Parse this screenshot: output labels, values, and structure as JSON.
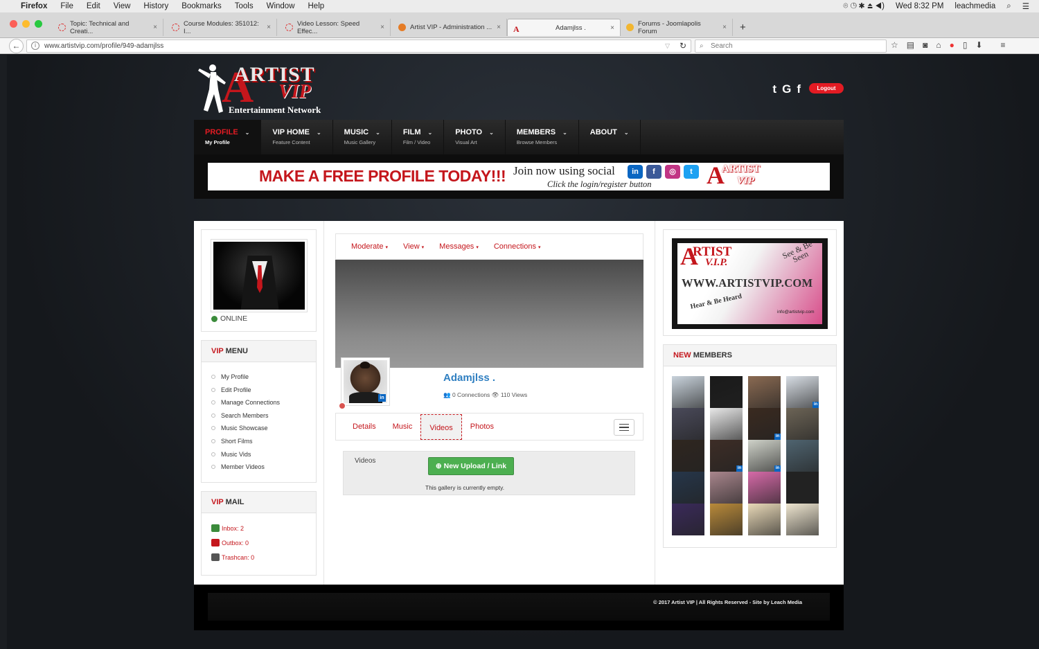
{
  "os_menubar": {
    "app": "Firefox",
    "menus": [
      "File",
      "Edit",
      "View",
      "History",
      "Bookmarks",
      "Tools",
      "Window",
      "Help"
    ],
    "clock": "Wed 8:32 PM",
    "user": "leachmedia"
  },
  "browser": {
    "tabs": [
      {
        "title": "Topic: Technical and Creati..."
      },
      {
        "title": "Course Modules: 351012: I..."
      },
      {
        "title": "Video Lesson: Speed Effec..."
      },
      {
        "title": "Artist VIP - Administration ..."
      },
      {
        "title": "Adamjlss ."
      },
      {
        "title": "Forums - Joomlapolis Forum"
      }
    ],
    "url": "www.artistvip.com/profile/949-adamjlss",
    "search_placeholder": "Search"
  },
  "site": {
    "logo": {
      "line1": "ARTIST",
      "line2": "VIP",
      "tagline": "Entertainment Network"
    },
    "social": [
      "t",
      "G",
      "f"
    ],
    "logout_label": "Logout",
    "nav": [
      {
        "title": "PROFILE",
        "sub": "My Profile",
        "active": true
      },
      {
        "title": "VIP HOME",
        "sub": "Feature Content"
      },
      {
        "title": "MUSIC",
        "sub": "Music Gallery"
      },
      {
        "title": "FILM",
        "sub": "Film / Video"
      },
      {
        "title": "PHOTO",
        "sub": "Visual Art"
      },
      {
        "title": "MEMBERS",
        "sub": "Browse Members"
      },
      {
        "title": "ABOUT",
        "sub": ""
      }
    ],
    "banner": {
      "headline": "MAKE A FREE PROFILE TODAY!!!",
      "join": "Join now using social",
      "click": "Click the login/register button"
    }
  },
  "left": {
    "status": "ONLINE",
    "vip_menu_title_red": "VIP",
    "vip_menu_title": " MENU",
    "vip_menu": [
      "My Profile",
      "Edit Profile",
      "Manage Connections",
      "Search Members",
      "Music Showcase",
      "Short Films",
      "Music Vids",
      "Member Videos"
    ],
    "vip_mail_title_red": "VIP",
    "vip_mail_title": " MAIL",
    "mail": [
      {
        "label": "Inbox: 2",
        "color": "#3b8b3b"
      },
      {
        "label": "Outbox: 0",
        "color": "#c4161c"
      },
      {
        "label": "Trashcan: 0",
        "color": "#555555"
      }
    ]
  },
  "profile": {
    "actions": [
      "Moderate",
      "View",
      "Messages",
      "Connections"
    ],
    "name": "Adamjlss .",
    "stats": "0 Connections  👁 110 Views",
    "tabs": [
      {
        "label": "Details"
      },
      {
        "label": "Music"
      },
      {
        "label": "Videos",
        "active": true
      },
      {
        "label": "Photos"
      }
    ],
    "videos_label": "Videos",
    "upload_button": "New Upload / Link",
    "empty_text": "This gallery is currently empty."
  },
  "right": {
    "ad": {
      "artist": "RTIST",
      "vip": "V.I.P.",
      "see": "See & Be Seen",
      "www": "WWW.ARTISTVIP.COM",
      "hear": "Hear & Be Heard",
      "email": "info@artistvip.com"
    },
    "new_members_red": "NEW",
    "new_members": " MEMBERS",
    "members": [
      {
        "c": "#c9d3dc",
        "li": false
      },
      {
        "c": "#1a1a1a",
        "li": false
      },
      {
        "c": "#8a6a52",
        "li": false
      },
      {
        "c": "#d7dde4",
        "li": true
      },
      {
        "c": "#4a4a5a",
        "li": false
      },
      {
        "c": "#e8e8e8",
        "li": false
      },
      {
        "c": "#3a2a20",
        "li": true
      },
      {
        "c": "#6c6456",
        "li": false
      },
      {
        "c": "#2f2620",
        "li": false
      },
      {
        "c": "#3d2d26",
        "li": true
      },
      {
        "c": "#cfd2c9",
        "li": true
      },
      {
        "c": "#4f6470",
        "li": false
      },
      {
        "c": "#26364a",
        "li": false
      },
      {
        "c": "#a9868d",
        "li": false
      },
      {
        "c": "#d66aa8",
        "li": false
      },
      {
        "c": "#222222",
        "li": false
      },
      {
        "c": "#3a2a5a",
        "li": false
      },
      {
        "c": "#b98a3a",
        "li": false
      },
      {
        "c": "#e9d9b8",
        "li": false
      },
      {
        "c": "#efe6d0",
        "li": false
      }
    ]
  },
  "footer": {
    "text": "© 2017 Artist VIP | All Rights Reserved - Site by Leach Media"
  }
}
